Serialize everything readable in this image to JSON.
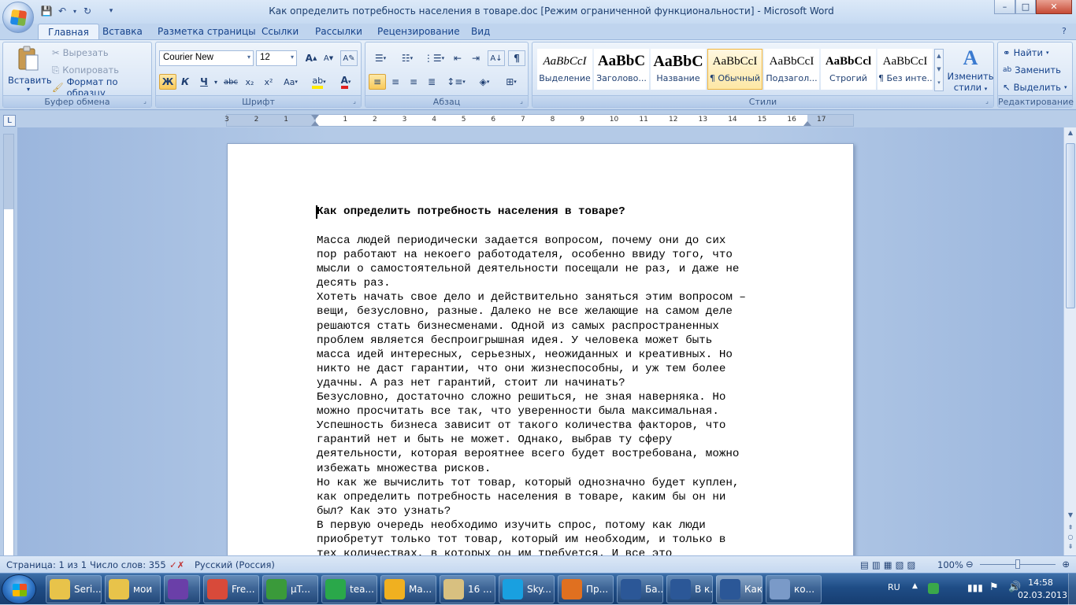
{
  "window": {
    "title": "Как определить потребность населения в товаре.doc [Режим ограниченной функциональности] - Microsoft Word",
    "controls": {
      "minimize": "–",
      "maximize": "□",
      "close": "✕"
    }
  },
  "qat": {
    "save_icon": "💾",
    "undo_icon": "↶",
    "redo_icon": "↻",
    "menu_icon": "▾"
  },
  "tabs": [
    "Главная",
    "Вставка",
    "Разметка страницы",
    "Ссылки",
    "Рассылки",
    "Рецензирование",
    "Вид"
  ],
  "ribbon": {
    "clipboard": {
      "label": "Буфер обмена",
      "paste": "Вставить",
      "cut": "Вырезать",
      "copy": "Копировать",
      "format_painter": "Формат по образцу"
    },
    "font": {
      "label": "Шрифт",
      "font_name": "Courier New",
      "font_size": "12",
      "grow": "A",
      "shrink": "A",
      "bold": "Ж",
      "italic": "К",
      "underline": "Ч",
      "strike": "abc",
      "subscript": "x₂",
      "superscript": "x²",
      "case": "Aa"
    },
    "paragraph": {
      "label": "Абзац"
    },
    "styles": {
      "label": "Стили",
      "tiles": [
        {
          "preview": "AaBbCcI",
          "name": "Выделение"
        },
        {
          "preview": "AaBbC",
          "name": "Заголово..."
        },
        {
          "preview": "AaBbC",
          "name": "Название"
        },
        {
          "preview": "AaBbCcI",
          "name": "¶ Обычный"
        },
        {
          "preview": "AaBbCcI",
          "name": "Подзагол..."
        },
        {
          "preview": "AaBbCcl",
          "name": "Строгий"
        },
        {
          "preview": "AaBbCcI",
          "name": "¶ Без инте..."
        }
      ],
      "change_styles_line1": "Изменить",
      "change_styles_line2": "стили"
    },
    "editing": {
      "label": "Редактирование",
      "find": "Найти",
      "replace": "Заменить",
      "select": "Выделить"
    }
  },
  "ruler": {
    "corner": "L",
    "ticks": [
      "3",
      "2",
      "1",
      "",
      "1",
      "2",
      "3",
      "4",
      "5",
      "6",
      "7",
      "8",
      "9",
      "10",
      "11",
      "12",
      "13",
      "14",
      "15",
      "16",
      "17"
    ]
  },
  "document": {
    "title": "Как определить потребность населения в товаре?",
    "lines": [
      "Масса людей периодически задается вопросом, почему они до сих",
      "пор работают на некоего работодателя, особенно ввиду того, что",
      "мысли о самостоятельной деятельности посещали не раз, и даже не",
      "десять раз.",
      "Хотеть начать свое дело и действительно заняться этим вопросом –",
      "вещи, безусловно, разные. Далеко не все желающие на самом деле",
      "решаются стать бизнесменами. Одной из самых распространенных",
      "проблем является беспроигрышная идея. У человека может быть",
      "масса идей интересных, серьезных, неожиданных и креативных. Но",
      "никто не даст гарантии, что они жизнеспособны, и уж тем более",
      "удачны. А раз нет гарантий, стоит ли начинать?",
      "Безусловно, достаточно сложно решиться, не зная наверняка. Но",
      "можно просчитать все так, что уверенности была максимальная.",
      "Успешность бизнеса зависит от такого количества факторов, что",
      "гарантий нет и быть не может. Однако, выбрав ту сферу",
      "деятельности, которая вероятнее всего будет востребована, можно",
      "избежать множества рисков.",
      "Но как же вычислить тот товар, который однозначно будет куплен,",
      "как определить потребность населения в товаре, каким бы он ни",
      "был? Как это узнать?",
      "В первую очередь необходимо изучить спрос, потому как люди",
      "приобретут только тот товар, который им необходим, и только в",
      "тех количествах, в которых он им требуется. И все это"
    ]
  },
  "status": {
    "page": "Страница: 1 из 1",
    "words": "Число слов: 355",
    "language": "Русский (Россия)",
    "zoom": "100%"
  },
  "taskbar": {
    "items": [
      {
        "label": "Seri...",
        "icon": "folder-icon",
        "color": "#e8c34a"
      },
      {
        "label": "мои",
        "icon": "folder-icon",
        "color": "#e8c34a"
      },
      {
        "label": "",
        "icon": "visual-studio-icon",
        "color": "#6a3fa8"
      },
      {
        "label": "Fre...",
        "icon": "chrome-icon",
        "color": "#d84a3a"
      },
      {
        "label": "µT...",
        "icon": "utorrent-icon",
        "color": "#3a9a3a"
      },
      {
        "label": "tea...",
        "icon": "icq-icon",
        "color": "#2aa84a"
      },
      {
        "label": "Ma...",
        "icon": "mail-agent-icon",
        "color": "#f0b020"
      },
      {
        "label": "16 ...",
        "icon": "mail-icon",
        "color": "#d8c080"
      },
      {
        "label": "Sky...",
        "icon": "skype-icon",
        "color": "#19a0e0"
      },
      {
        "label": "Пр...",
        "icon": "player-icon",
        "color": "#e07020"
      },
      {
        "label": "Ба...",
        "icon": "word-icon",
        "color": "#2b5797"
      },
      {
        "label": "В к...",
        "icon": "word-icon",
        "color": "#2b5797"
      },
      {
        "label": "Как...",
        "icon": "word-icon",
        "color": "#2b5797"
      },
      {
        "label": "ко...",
        "icon": "paint-icon",
        "color": "#7a9ac8"
      }
    ],
    "tray": {
      "lang": "RU",
      "time": "14:58",
      "date": "02.03.2013"
    }
  }
}
